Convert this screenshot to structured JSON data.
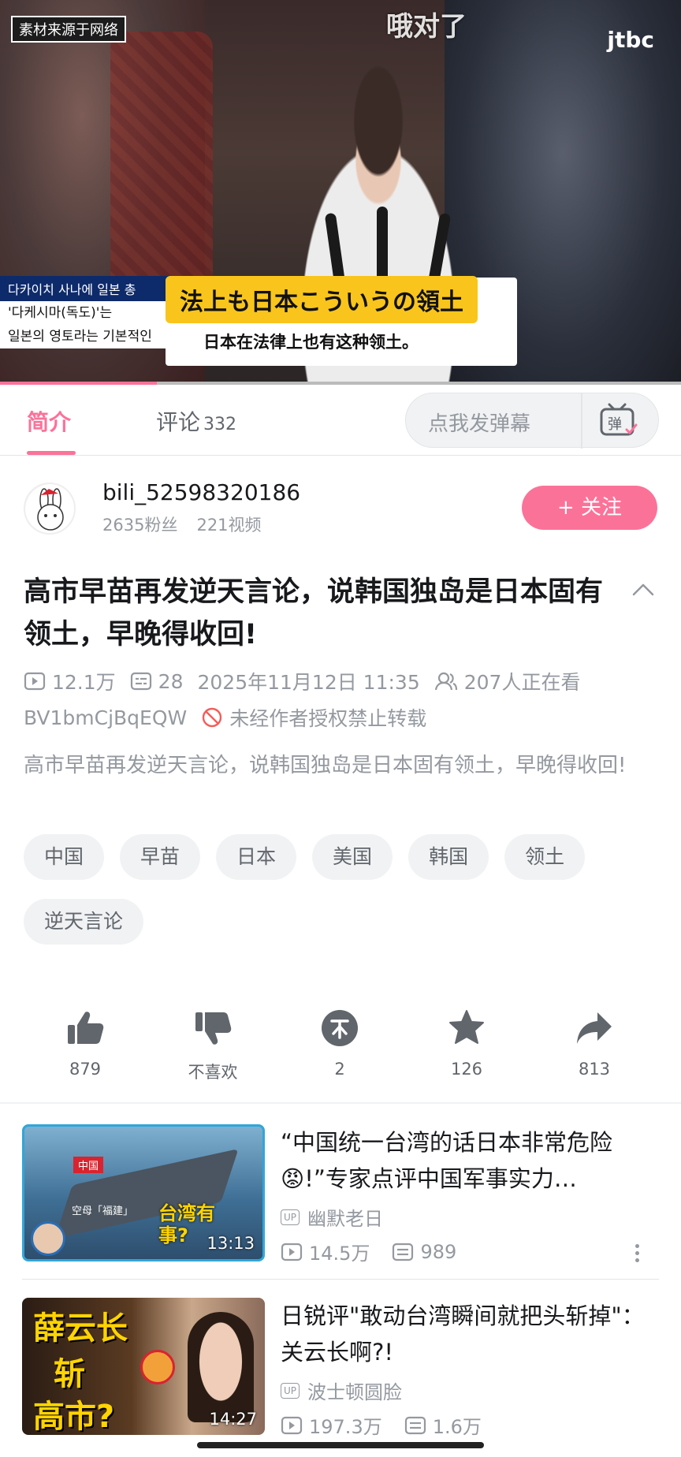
{
  "video": {
    "watermark_left": "素材来源于网络",
    "watermark_center": "哦对了",
    "channel_logo": "jtbc",
    "korean_caption_line1": "다카이치 사나에 일본 총",
    "korean_caption_line2": "'다케시마(독도)'는",
    "korean_caption_line3": "일본의 영토라는 기본적인",
    "subtitle_jp": "法上も日本こういうの領土",
    "subtitle_cn": "日本在法律上也有这种领土。",
    "progress_fraction": 0.23
  },
  "tabs": {
    "intro": "简介",
    "comments": "评论",
    "comments_count": "332",
    "danmaku_placeholder": "点我发弹幕",
    "danmaku_button": "弹"
  },
  "uploader": {
    "name": "bili_52598320186",
    "fans": "2635粉丝",
    "videos": "221视频",
    "follow_label": "+ 关注"
  },
  "video_info": {
    "title": "高市早苗再发逆天言论，说韩国独岛是日本固有领土，早晚得收回!",
    "views": "12.1万",
    "danmaku_count": "28",
    "datetime": "2025年11月12日 11:35",
    "watching": "207人正在看",
    "bvid": "BV1bmCjBqEQW",
    "copyright": "未经作者授权禁止转载",
    "description": "高市早苗再发逆天言论，说韩国独岛是日本固有领土，早晚得收回!"
  },
  "tags": [
    "中国",
    "早苗",
    "日本",
    "美国",
    "韩国",
    "领土",
    "逆天言论"
  ],
  "actions": {
    "like": "879",
    "dislike": "不喜欢",
    "coin": "2",
    "favorite": "126",
    "share": "813"
  },
  "recommendations": [
    {
      "title": "“中国统一台湾的话日本非常危险😡!”专家点评中国军事实力…",
      "uploader": "幽默老日",
      "views": "14.5万",
      "danmaku": "989",
      "duration": "13:13",
      "thumb_text_1": "中国",
      "thumb_text_2": "空母「福建」",
      "thumb_text_3": "台湾有事?"
    },
    {
      "title": "日锐评\"敢动台湾瞬间就把头斩掉\"：关云长啊?!",
      "uploader": "波士顿圆脸",
      "views": "197.3万",
      "danmaku": "1.6万",
      "duration": "14:27",
      "thumb_text_1": "薛云长",
      "thumb_text_2": "斩",
      "thumb_text_3": "高市?"
    }
  ],
  "colors": {
    "accent": "#fb7299",
    "text_primary": "#18191c",
    "text_secondary": "#9499a0",
    "tag_bg": "#f1f2f3"
  }
}
